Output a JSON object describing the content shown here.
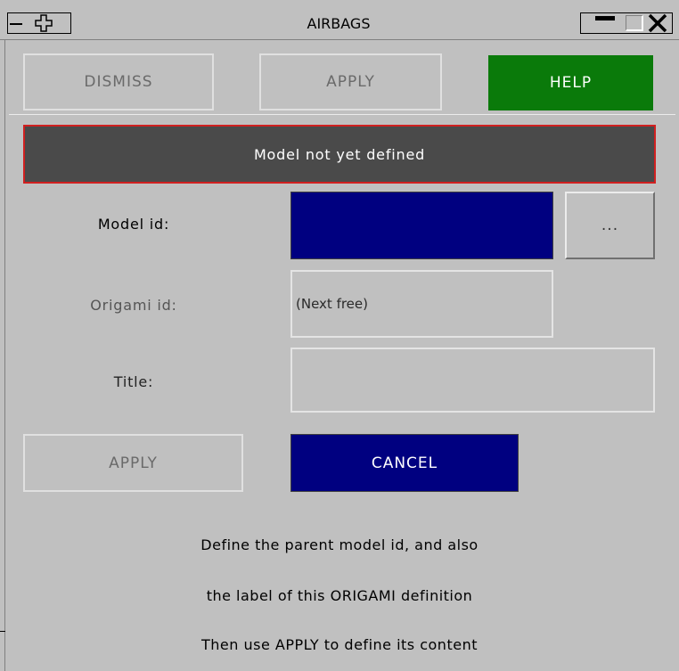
{
  "window": {
    "title": "AIRBAGS"
  },
  "toolbar": {
    "dismiss": "DISMISS",
    "apply": "APPLY",
    "help": "HELP"
  },
  "status": {
    "message": "Model not yet defined",
    "border_color": "#d02020",
    "background": "#4a4a4a"
  },
  "form": {
    "model_id_label": "Model id:",
    "model_id_value": "",
    "browse_label": "...",
    "origami_id_label": "Origami id:",
    "origami_id_value": "(Next free)",
    "title_label": "Title:",
    "title_value": ""
  },
  "actions": {
    "apply": "APPLY",
    "cancel": "CANCEL"
  },
  "help_text": {
    "line1": "Define the parent model id, and also",
    "line2": "the label of this ORIGAMI definition",
    "line3": "Then use APPLY to define its content"
  },
  "icons": {
    "window_menu": "dash-icon",
    "move": "move-cross-icon",
    "minimize": "minimize-icon",
    "maximize": "maximize-icon",
    "close": "close-icon"
  },
  "colors": {
    "help_button": "#0a7a0a",
    "navy": "#000080",
    "panel": "#c0c0c0"
  }
}
